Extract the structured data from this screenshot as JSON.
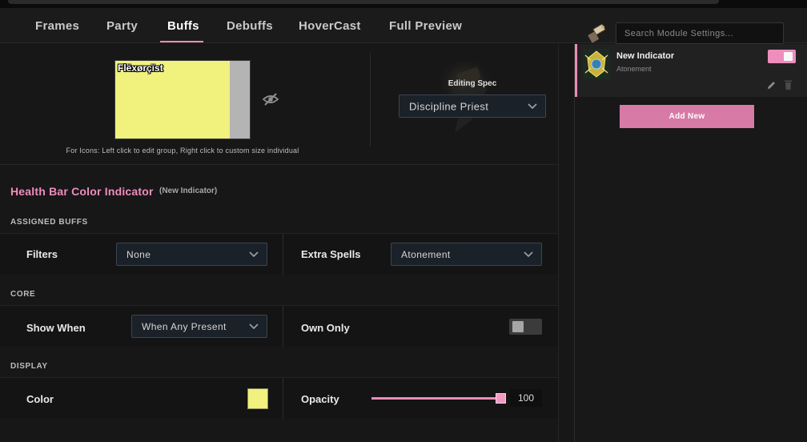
{
  "tabs": [
    {
      "label": "Frames",
      "active": false
    },
    {
      "label": "Party",
      "active": false
    },
    {
      "label": "Buffs",
      "active": true
    },
    {
      "label": "Debuffs",
      "active": false
    },
    {
      "label": "HoverCast",
      "active": false
    },
    {
      "label": "Full Preview",
      "active": false
    }
  ],
  "search": {
    "placeholder": "Search Module Settings...",
    "value": "",
    "icon": "hammer-icon"
  },
  "preview": {
    "unit_name": "Flëxørçïst",
    "bar_color": "#f1f17d",
    "hint": "For Icons: Left click to edit group, Right click to custom size individual",
    "visibility_icon": "eye-slash-icon"
  },
  "spec": {
    "label": "Editing Spec",
    "value": "Discipline Priest"
  },
  "indicator_settings": {
    "title": "Health Bar Color Indicator",
    "subtitle": "(New Indicator)",
    "sections": {
      "assigned_buffs": {
        "label": "ASSIGNED BUFFS",
        "filters_label": "Filters",
        "filters_value": "None",
        "extra_spells_label": "Extra Spells",
        "extra_spells_value": "Atonement"
      },
      "core": {
        "label": "CORE",
        "show_when_label": "Show When",
        "show_when_value": "When Any Present",
        "own_only_label": "Own Only",
        "own_only_enabled": false
      },
      "display": {
        "label": "DISPLAY",
        "color_label": "Color",
        "color_value": "#f1f17d",
        "opacity_label": "Opacity",
        "opacity_value": "100"
      }
    }
  },
  "indicators_list": [
    {
      "name": "New Indicator",
      "spell": "Atonement",
      "enabled": true,
      "icon": "atonement-spell-icon"
    }
  ],
  "add_new_label": "Add New",
  "colors": {
    "accent": "#e98db6",
    "background": "#161616",
    "panel": "#181818"
  }
}
